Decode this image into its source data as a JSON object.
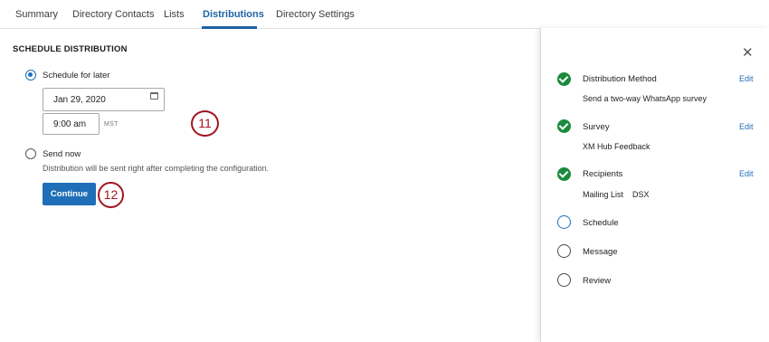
{
  "tabs": [
    {
      "label": "Summary"
    },
    {
      "label": "Directory Contacts"
    },
    {
      "label": "Lists"
    },
    {
      "label": "Distributions"
    },
    {
      "label": "Directory Settings"
    }
  ],
  "active_tab": "Distributions",
  "schedule": {
    "title": "SCHEDULE DISTRIBUTION",
    "later_label": "Schedule for later",
    "date_value": "Jan 29, 2020",
    "time_value": "9:00 am",
    "timezone": "MST",
    "now_label": "Send now",
    "now_description": "Distribution will be sent right after completing the configuration.",
    "continue_label": "Continue",
    "selected_option": "Schedule for later"
  },
  "markers": {
    "date_time": "11",
    "continue": "12"
  },
  "side_panel": {
    "edit_label": "Edit",
    "steps": [
      {
        "title": "Distribution Method",
        "detail": "Send a two-way WhatsApp survey",
        "status": "complete"
      },
      {
        "title": "Survey",
        "detail": "XM Hub Feedback",
        "status": "complete"
      },
      {
        "title": "Recipients",
        "detail": "Mailing List    DSX",
        "status": "complete"
      },
      {
        "title": "Schedule",
        "detail": "",
        "status": "current"
      },
      {
        "title": "Message",
        "detail": "",
        "status": "pending"
      },
      {
        "title": "Review",
        "detail": "",
        "status": "pending"
      }
    ]
  },
  "colors": {
    "accent": "#1f6fb8",
    "complete": "#1a8a3c",
    "marker": "#a31421"
  }
}
